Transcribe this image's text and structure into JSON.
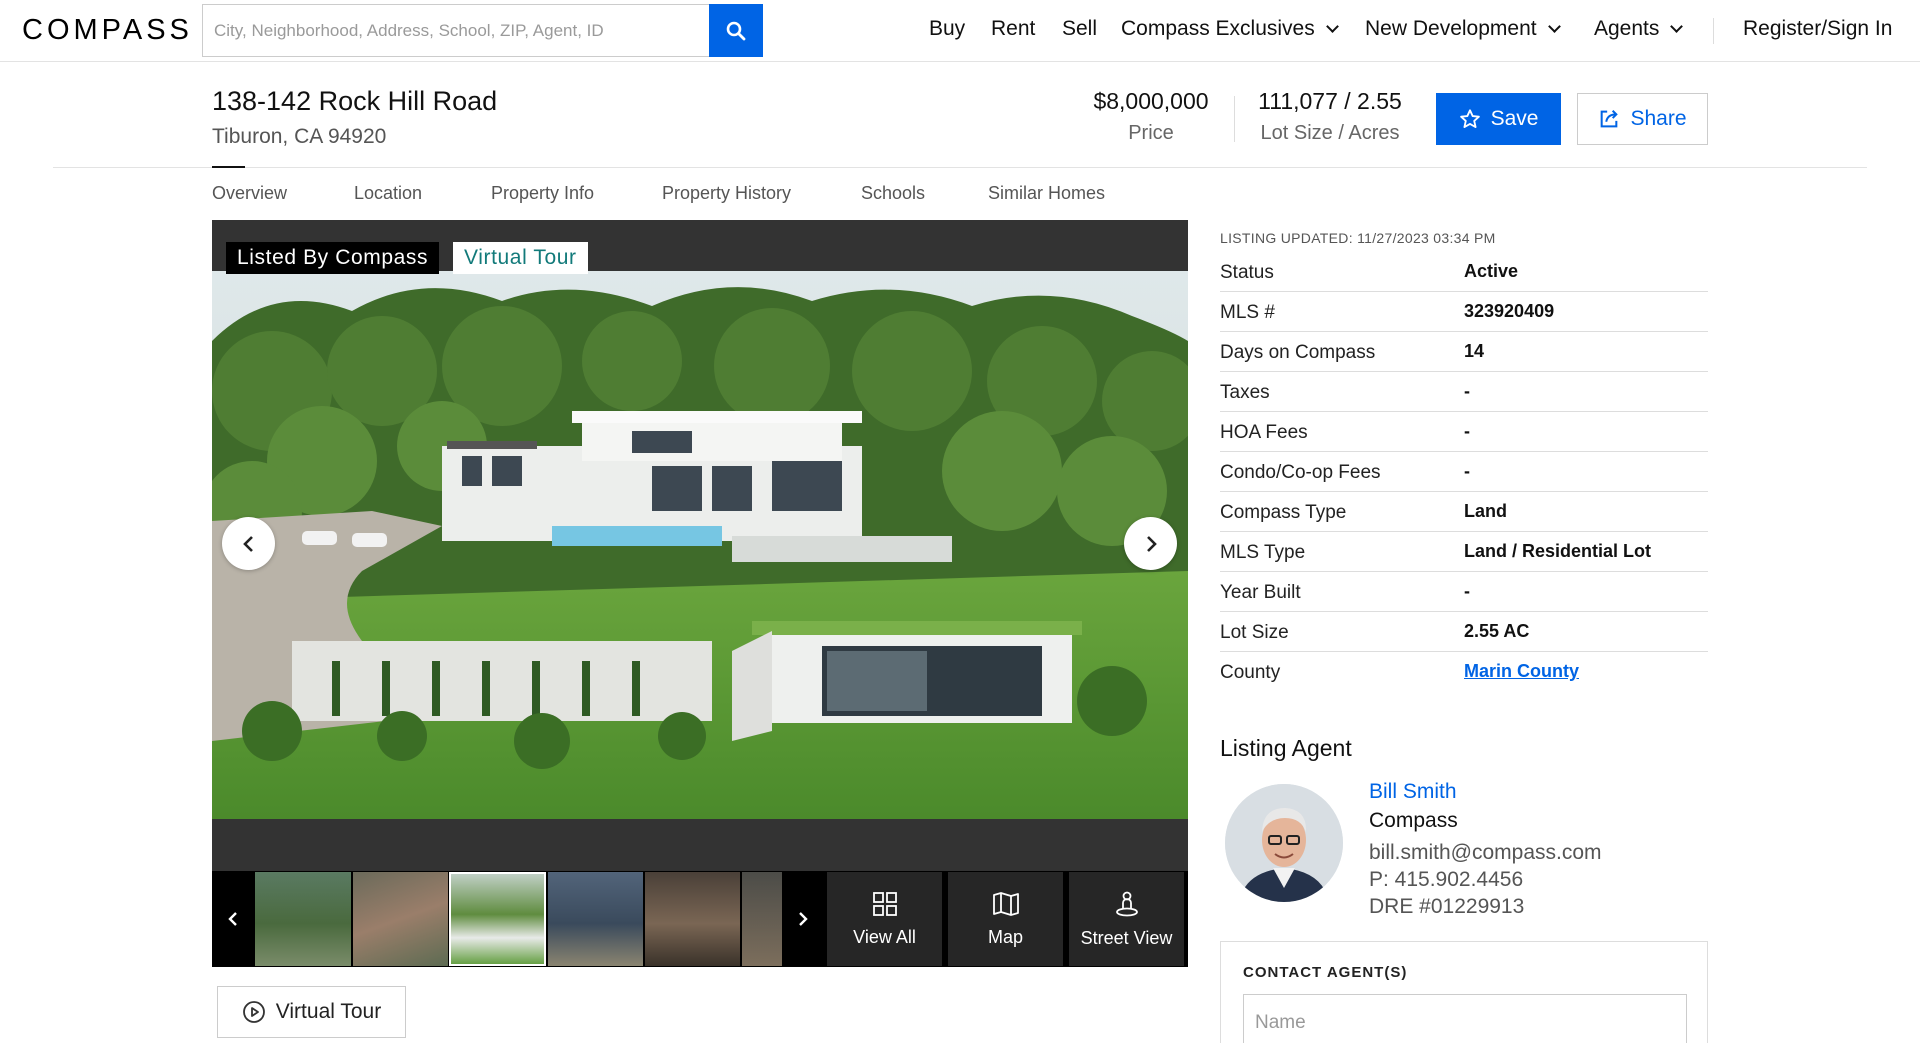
{
  "header": {
    "logo": "COMPASS",
    "search_placeholder": "City, Neighborhood, Address, School, ZIP, Agent, ID",
    "nav": [
      "Buy",
      "Rent",
      "Sell",
      "Compass Exclusives",
      "New Development",
      "Agents"
    ],
    "register": "Register/Sign In"
  },
  "listing": {
    "address": "138-142 Rock Hill Road",
    "city": "Tiburon, CA 94920",
    "price": "$8,000,000",
    "price_label": "Price",
    "lot": "111,077 / 2.55",
    "lot_label": "Lot Size / Acres",
    "save": "Save",
    "share": "Share"
  },
  "tabs": [
    "Overview",
    "Location",
    "Property Info",
    "Property History",
    "Schools",
    "Similar Homes"
  ],
  "gallery": {
    "badge_listed": "Listed By Compass",
    "badge_tour": "Virtual Tour",
    "actions": [
      "View All",
      "Map",
      "Street View"
    ],
    "virtual_tour_button": "Virtual Tour"
  },
  "details": {
    "updated": "LISTING UPDATED: 11/27/2023 03:34 PM",
    "rows": [
      {
        "k": "Status",
        "v": "Active"
      },
      {
        "k": "MLS #",
        "v": "323920409"
      },
      {
        "k": "Days on Compass",
        "v": "14"
      },
      {
        "k": "Taxes",
        "v": "-"
      },
      {
        "k": "HOA Fees",
        "v": "-"
      },
      {
        "k": "Condo/Co-op Fees",
        "v": "-"
      },
      {
        "k": "Compass Type",
        "v": "Land"
      },
      {
        "k": "MLS Type",
        "v": "Land / Residential Lot"
      },
      {
        "k": "Year Built",
        "v": "-"
      },
      {
        "k": "Lot Size",
        "v": "2.55 AC"
      },
      {
        "k": "County",
        "v": "Marin County"
      }
    ]
  },
  "agent": {
    "heading": "Listing Agent",
    "name": "Bill Smith",
    "company": "Compass",
    "email": "bill.smith@compass.com",
    "phone": "P: 415.902.4456",
    "dre": "DRE #01229913"
  },
  "contact": {
    "heading": "CONTACT AGENT(S)",
    "name_placeholder": "Name"
  },
  "colors": {
    "brand": "#0064e5",
    "tour_badge": "#127a7a"
  }
}
